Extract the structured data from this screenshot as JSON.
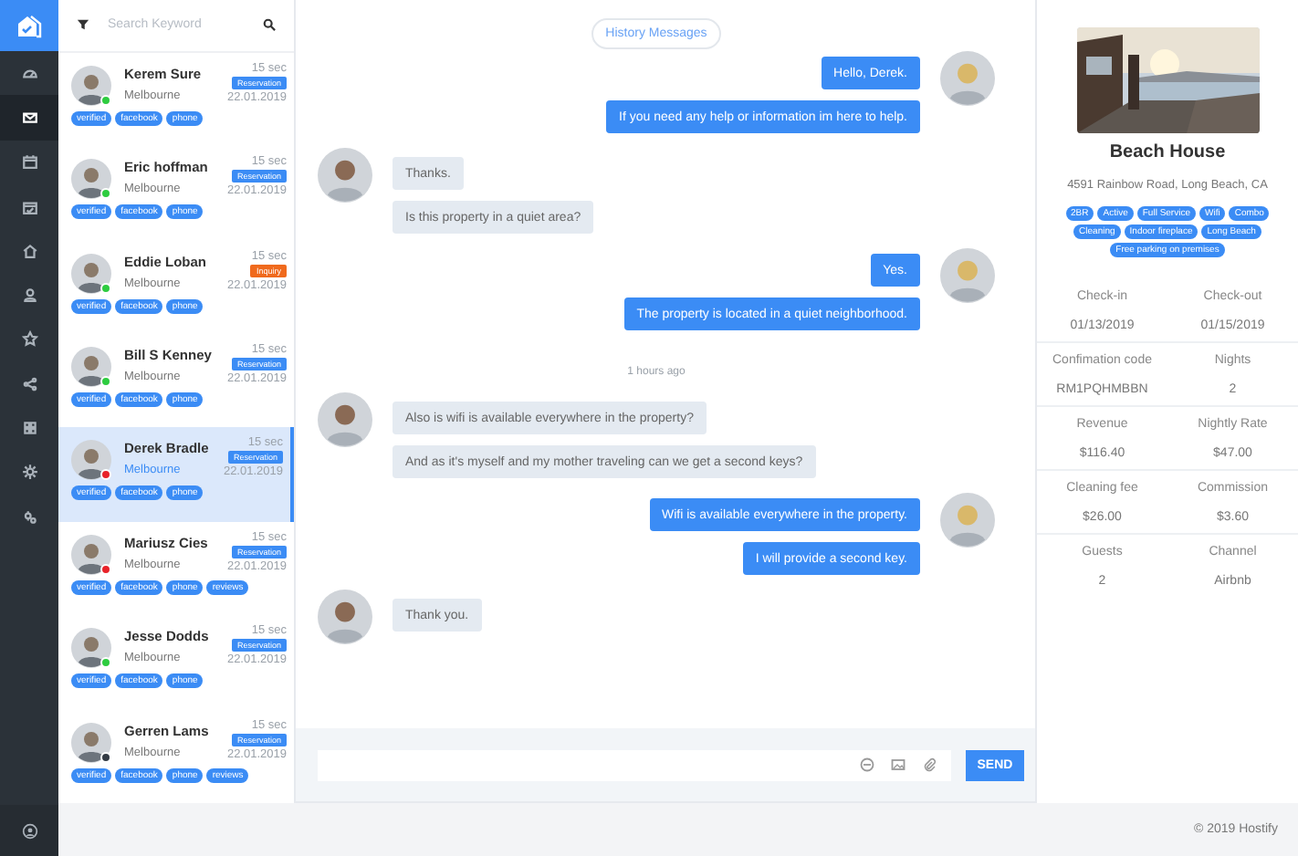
{
  "sidebar": {
    "items": [
      {
        "selected": false
      },
      {
        "selected": true
      },
      {
        "selected": false
      },
      {
        "selected": false
      },
      {
        "selected": false
      },
      {
        "selected": false
      },
      {
        "selected": false
      },
      {
        "selected": false
      },
      {
        "selected": false
      },
      {
        "selected": false
      },
      {
        "selected": false
      }
    ]
  },
  "contacts": {
    "search": {
      "placeholder": "Search Keyword"
    },
    "items": [
      {
        "name": "Kerem Sure",
        "city": "Melbourne",
        "time": "15 sec",
        "badge": {
          "text": "Reservation",
          "kind": "reservation"
        },
        "date": "22.01.2019",
        "color": "#2ecc40",
        "selected": false,
        "tags": [
          "verified",
          "facebook",
          "phone"
        ]
      },
      {
        "name": "Eric hoffman",
        "city": "Melbourne",
        "time": "15 sec",
        "badge": {
          "text": "Reservation",
          "kind": "reservation"
        },
        "date": "22.01.2019",
        "color": "#2ecc40",
        "selected": false,
        "tags": [
          "verified",
          "facebook",
          "phone"
        ]
      },
      {
        "name": "Eddie Loban",
        "city": "Melbourne",
        "time": "15 sec",
        "badge": {
          "text": "Inquiry",
          "kind": "inquiry"
        },
        "date": "22.01.2019",
        "color": "#2ecc40",
        "selected": false,
        "tags": [
          "verified",
          "facebook",
          "phone"
        ]
      },
      {
        "name": "Bill S Kenney",
        "city": "Melbourne",
        "time": "15 sec",
        "badge": {
          "text": "Reservation",
          "kind": "reservation"
        },
        "date": "22.01.2019",
        "color": "#2ecc40",
        "selected": false,
        "tags": [
          "verified",
          "facebook",
          "phone"
        ]
      },
      {
        "name": "Derek Bradle",
        "city": "Melbourne",
        "time": "15 sec",
        "badge": {
          "text": "Reservation",
          "kind": "reservation"
        },
        "date": "22.01.2019",
        "color": "#e8232a",
        "selected": true,
        "tags": [
          "verified",
          "facebook",
          "phone"
        ]
      },
      {
        "name": "Mariusz Cies",
        "city": "Melbourne",
        "time": "15 sec",
        "badge": {
          "text": "Reservation",
          "kind": "reservation"
        },
        "date": "22.01.2019",
        "color": "#e8232a",
        "selected": false,
        "tags": [
          "verified",
          "facebook",
          "phone",
          "reviews"
        ]
      },
      {
        "name": "Jesse Dodds",
        "city": "Melbourne",
        "time": "15 sec",
        "badge": {
          "text": "Reservation",
          "kind": "reservation"
        },
        "date": "22.01.2019",
        "color": "#2ecc40",
        "selected": false,
        "tags": [
          "verified",
          "facebook",
          "phone"
        ]
      },
      {
        "name": "Gerren Lams",
        "city": "Melbourne",
        "time": "15 sec",
        "badge": {
          "text": "Reservation",
          "kind": "reservation"
        },
        "date": "22.01.2019",
        "color": "#333b44",
        "selected": false,
        "tags": [
          "verified",
          "facebook",
          "phone",
          "reviews"
        ]
      }
    ]
  },
  "chat": {
    "history_button": "History Messages",
    "blocks": [
      {
        "kind": "outgoing",
        "messages": [
          "Hello, Derek.",
          "If you need any help or information im here to help."
        ]
      },
      {
        "kind": "incoming",
        "messages": [
          "Thanks.",
          "Is this property in a quiet area?"
        ]
      },
      {
        "kind": "outgoing",
        "messages": [
          "Yes.",
          "The property is located in a quiet neighborhood."
        ]
      },
      {
        "kind": "time",
        "text": "1 hours ago"
      },
      {
        "kind": "incoming",
        "messages": [
          "Also is wifi is available everywhere in the property?",
          "And as it's myself and my mother traveling can we get a second keys?"
        ]
      },
      {
        "kind": "outgoing",
        "messages": [
          "Wifi is available everywhere in the property.",
          "I will provide a second key."
        ]
      },
      {
        "kind": "incoming",
        "messages": [
          "Thank you."
        ]
      }
    ],
    "send_button": "SEND"
  },
  "property": {
    "title": "Beach House",
    "address": "4591 Rainbow Road, Long Beach, CA",
    "tags": [
      "2BR",
      "Active",
      "Full Service",
      "Wifi",
      "Combo",
      "Cleaning",
      "Indoor fireplace",
      "Long Beach",
      "Free parking on premises"
    ],
    "details": [
      [
        {
          "label": "Check-in",
          "value": "01/13/2019"
        },
        {
          "label": "Check-out",
          "value": "01/15/2019"
        }
      ],
      [
        {
          "label": "Confimation code",
          "value": "RM1PQHMBBN"
        },
        {
          "label": "Nights",
          "value": "2"
        }
      ],
      [
        {
          "label": "Revenue",
          "value": "$116.40"
        },
        {
          "label": "Nightly Rate",
          "value": "$47.00"
        }
      ],
      [
        {
          "label": "Cleaning fee",
          "value": "$26.00"
        },
        {
          "label": "Commission",
          "value": "$3.60"
        }
      ],
      [
        {
          "label": "Guests",
          "value": "2"
        },
        {
          "label": "Channel",
          "value": "Airbnb"
        }
      ]
    ]
  },
  "footer": "© 2019 Hostify"
}
